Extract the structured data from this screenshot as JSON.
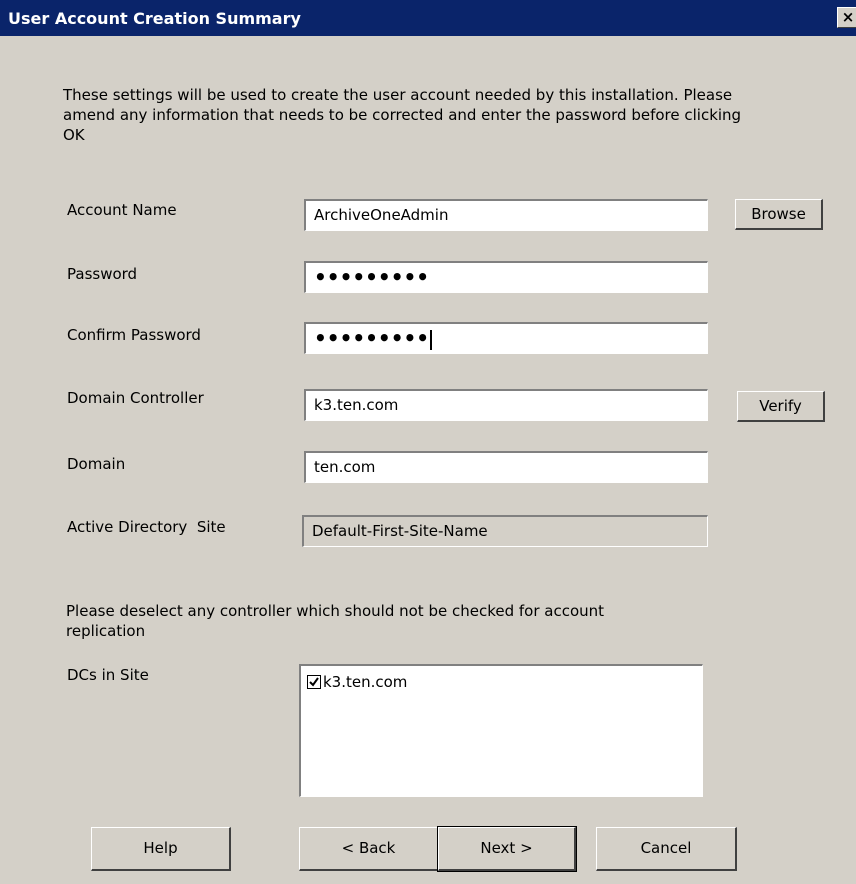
{
  "window": {
    "title": "User Account Creation Summary",
    "close_glyph": "×",
    "close_icon": "close-icon",
    "colors": {
      "title_bar": "#0a246a",
      "dialog_bg": "#d4d0c8",
      "field_bg": "#ffffff"
    }
  },
  "intro_text": "These settings will be used to create the user account needed by this installation. Please amend any information that needs to be corrected and enter the password before clicking OK",
  "form": {
    "account_name": {
      "label": "Account Name",
      "value": "ArchiveOneAdmin"
    },
    "password": {
      "label": "Password",
      "value": "•••••••••"
    },
    "confirm_password": {
      "label": "Confirm Password",
      "value": "•••••••••"
    },
    "domain_controller": {
      "label": "Domain Controller",
      "value": "k3.ten.com"
    },
    "domain": {
      "label": "Domain",
      "value": "ten.com"
    },
    "ad_site": {
      "label": "Active Directory  Site",
      "value": "Default-First-Site-Name"
    }
  },
  "buttons": {
    "browse": "Browse",
    "verify": "Verify",
    "help": "Help",
    "back": "< Back",
    "next": "Next >",
    "cancel": "Cancel"
  },
  "replication_text": "Please deselect any controller which should not be checked for account replication",
  "dcs": {
    "label": "DCs in Site",
    "items": [
      {
        "name": "k3.ten.com",
        "checked": true
      }
    ]
  }
}
